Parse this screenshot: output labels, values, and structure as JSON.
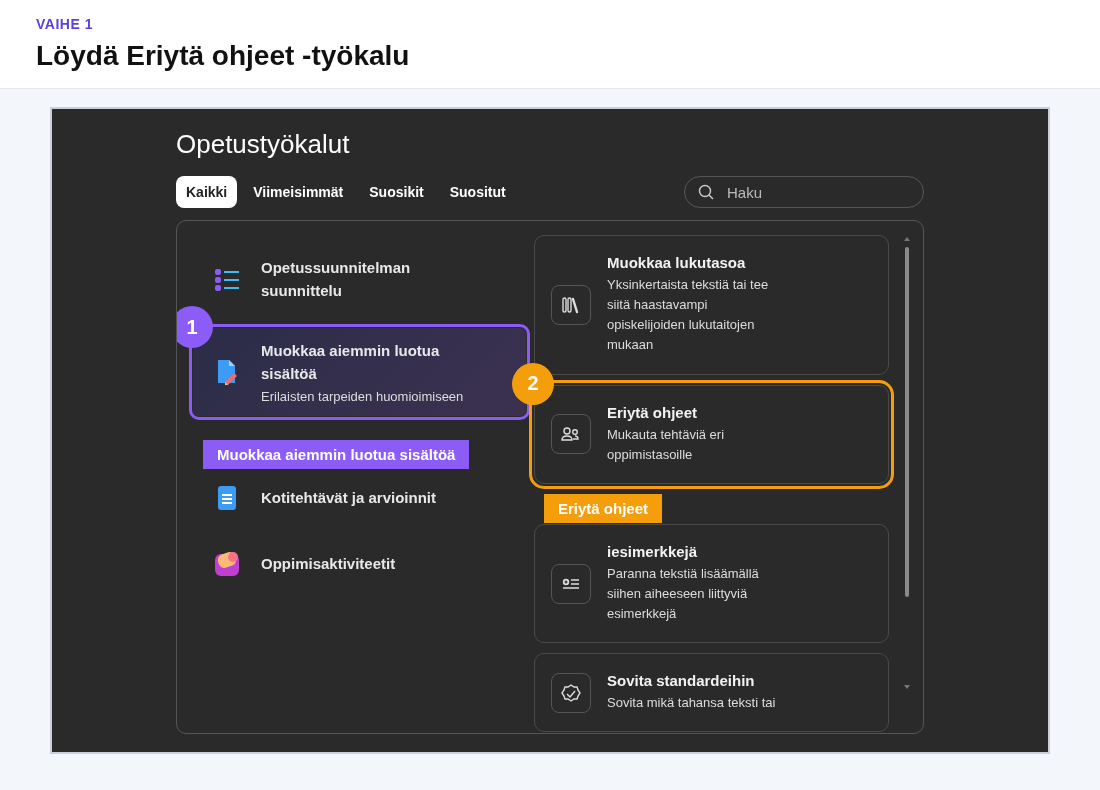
{
  "step": {
    "label": "VAIHE 1",
    "title": "Löydä Eriytä ohjeet -työkalu"
  },
  "app": {
    "title": "Opetustyökalut",
    "tabs": [
      {
        "label": "Kaikki",
        "selected": true
      },
      {
        "label": "Viimeisimmät",
        "selected": false
      },
      {
        "label": "Suosikit",
        "selected": false
      },
      {
        "label": "Suositut",
        "selected": false
      }
    ],
    "search": {
      "placeholder": "Haku"
    },
    "categories": [
      {
        "title": "Opetussuunnitelman suunnittelu",
        "selected": false
      },
      {
        "title": "Muokkaa aiemmin luotua sisältöä",
        "subtitle": "Erilaisten tarpeiden huomioimiseen",
        "selected": true,
        "callout": {
          "number": "1",
          "label": "Muokkaa aiemmin luotua sisältöä",
          "color": "#8b5cf6"
        }
      },
      {
        "title": "Kotitehtävät ja arvioinnit",
        "selected": false
      },
      {
        "title": "Oppimisaktiviteetit",
        "selected": false
      }
    ],
    "tools": [
      {
        "title": "Muokkaa lukutasoa",
        "description": "Yksinkertaista tekstiä tai tee siitä haastavampi opiskelijoiden lukutaitojen mukaan"
      },
      {
        "title": "Eriytä ohjeet",
        "description": "Mukauta tehtäviä eri oppimistasoille",
        "callout": {
          "number": "2",
          "label": "Eriytä ohjeet",
          "color": "#f59e0b"
        }
      },
      {
        "title": "iesimerkkejä",
        "description": "Paranna tekstiä lisäämällä siihen aiheeseen liittyviä esimerkkejä"
      },
      {
        "title": "Sovita standardeihin",
        "description": "Sovita mikä tahansa teksti tai"
      }
    ]
  }
}
